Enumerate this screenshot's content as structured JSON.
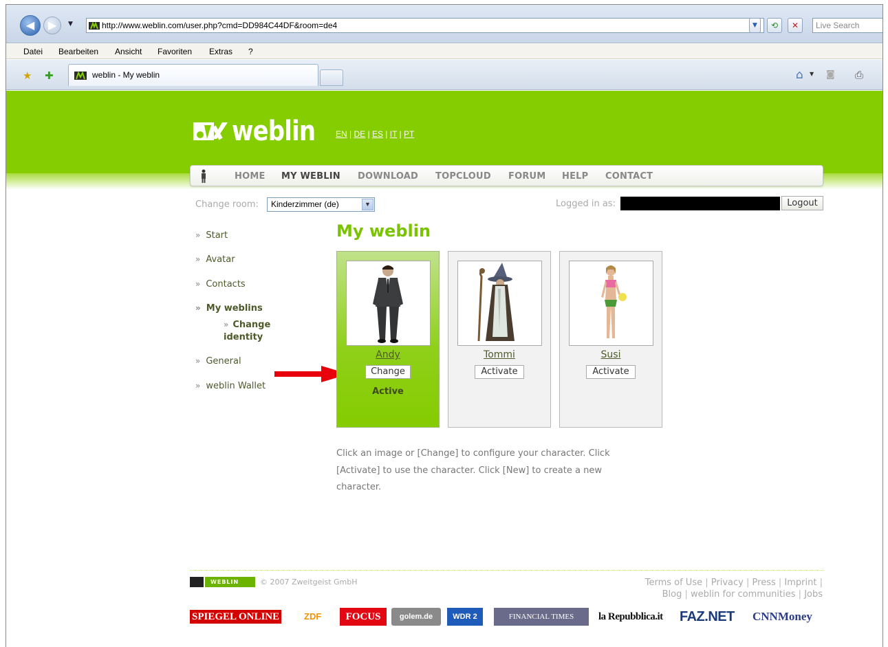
{
  "browser": {
    "url": "http://www.weblin.com/user.php?cmd=DD984C44DF&room=de4",
    "search_placeholder": "Live Search",
    "menu": [
      "Datei",
      "Bearbeiten",
      "Ansicht",
      "Favoriten",
      "Extras",
      "?"
    ],
    "tab_title": "weblin - My weblin"
  },
  "site": {
    "logo_text": "weblin",
    "languages": [
      "EN",
      "DE",
      "ES",
      "IT",
      "PT"
    ],
    "nav": [
      "HOME",
      "MY WEBLIN",
      "DOWNLOAD",
      "TOPCLOUD",
      "FORUM",
      "HELP",
      "CONTACT"
    ],
    "active_nav": "MY WEBLIN",
    "change_room_label": "Change room:",
    "room_value": "Kinderzimmer (de)",
    "logged_in_label": "Logged in as:",
    "logout_label": "Logout"
  },
  "sidebar": {
    "items": [
      "Start",
      "Avatar",
      "Contacts",
      "My weblins",
      "General",
      "weblin Wallet"
    ],
    "sub_item": "Change identity",
    "bullet": "»"
  },
  "main": {
    "title": "My weblin",
    "characters": [
      {
        "name": "Andy",
        "button": "Change",
        "status": "Active"
      },
      {
        "name": "Tommi",
        "button": "Activate",
        "status": ""
      },
      {
        "name": "Susi",
        "button": "Activate",
        "status": ""
      }
    ],
    "help_text": "Click an image or [Change] to configure your character. Click [Activate] to use the character. Click [New] to create a new character."
  },
  "footer": {
    "logo_label": "WEBLIN",
    "copyright": "© 2007 Zweitgeist GmbH",
    "links_row1": [
      "Terms of Use",
      "Privacy",
      "Press",
      "Imprint"
    ],
    "links_row2": [
      "Blog",
      "weblin for communities",
      "Jobs"
    ],
    "partners": [
      "SPIEGEL ONLINE",
      "ZDF",
      "FOCUS",
      "golem.de",
      "WDR 2",
      "FINANCIAL TIMES",
      "la Repubblica.it",
      "FAZ.NET",
      "CNNMoney"
    ]
  },
  "colors": {
    "brand_green": "#86cd00",
    "title_green": "#7ac300",
    "arrow_red": "#e8000a"
  }
}
